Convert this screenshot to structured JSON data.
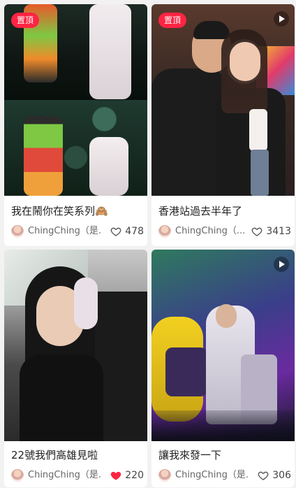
{
  "cards": [
    {
      "title": "我在鬧你在笑系列🙈",
      "author": "ChingChing（是...",
      "likes": "478",
      "liked": false,
      "pinned": true,
      "pin_label": "置頂",
      "video": false
    },
    {
      "title": "香港站過去半年了",
      "author": "ChingChing（...",
      "likes": "3413",
      "liked": false,
      "pinned": true,
      "pin_label": "置頂",
      "video": true
    },
    {
      "title": "22號我們高雄見啦",
      "author": "ChingChing（是...",
      "likes": "220",
      "liked": true,
      "pinned": false,
      "video": false
    },
    {
      "title": "讓我來發一下",
      "author": "ChingChing（是...",
      "likes": "306",
      "liked": false,
      "pinned": false,
      "video": true
    }
  ],
  "colors": {
    "pin_bg": "#ff2442",
    "heart_liked": "#ff2442",
    "heart_outline": "#555555"
  },
  "icons": [
    "play-icon",
    "heart-outline-icon",
    "heart-filled-icon",
    "avatar"
  ]
}
